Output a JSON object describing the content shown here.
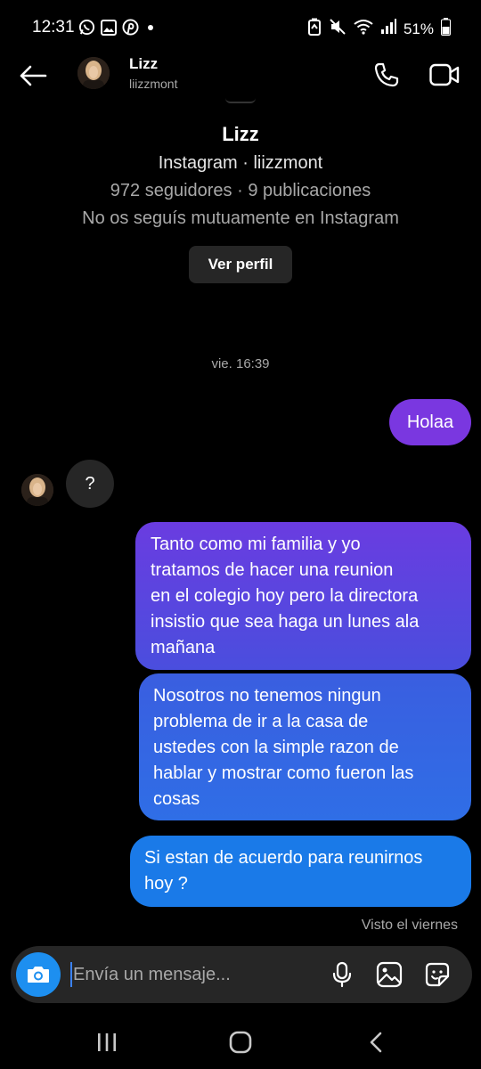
{
  "status_bar": {
    "time": "12:31",
    "battery": "51%",
    "left_icons": [
      "whatsapp-icon",
      "image-icon",
      "pinterest-icon",
      "dot-icon"
    ],
    "right_icons": [
      "battery-saver-icon",
      "mute-icon",
      "wifi-icon",
      "signal-icon",
      "battery-icon"
    ]
  },
  "header": {
    "name": "Lizz",
    "username": "liizzmont"
  },
  "profile": {
    "name": "Lizz",
    "platform_line": "Instagram · liizzmont",
    "stats_line": "972 seguidores · 9 publicaciones",
    "mutual_line": "No os seguís mutuamente en Instagram",
    "view_profile_label": "Ver perfil"
  },
  "conversation": {
    "timestamp": "vie. 16:39",
    "messages": [
      {
        "from": "me",
        "text": "Holaa"
      },
      {
        "from": "them",
        "text": "?"
      },
      {
        "from": "me",
        "lines": [
          "Tanto como mi familia y yo",
          "tratamos de hacer una reunion",
          "en el colegio hoy pero la directora",
          "insistio que sea haga un lunes ala",
          "mañana"
        ]
      },
      {
        "from": "me",
        "lines": [
          "Nosotros no tenemos ningun",
          "problema de ir a la casa de",
          "ustedes con la simple razon de",
          "hablar y mostrar como fueron las",
          "cosas"
        ]
      },
      {
        "from": "me",
        "lines": [
          "Si estan de acuerdo para reunirnos",
          "hoy ?"
        ]
      }
    ],
    "seen_label": "Visto el viernes"
  },
  "composer": {
    "placeholder": "Envía un mensaje..."
  },
  "colors": {
    "bubble_purple": "#7a37e0",
    "bubble_indigo": "#5a45e0",
    "bubble_blue": "#1a7ae8",
    "incoming_bubble": "#262626",
    "camera_button": "#1d8ff0"
  }
}
